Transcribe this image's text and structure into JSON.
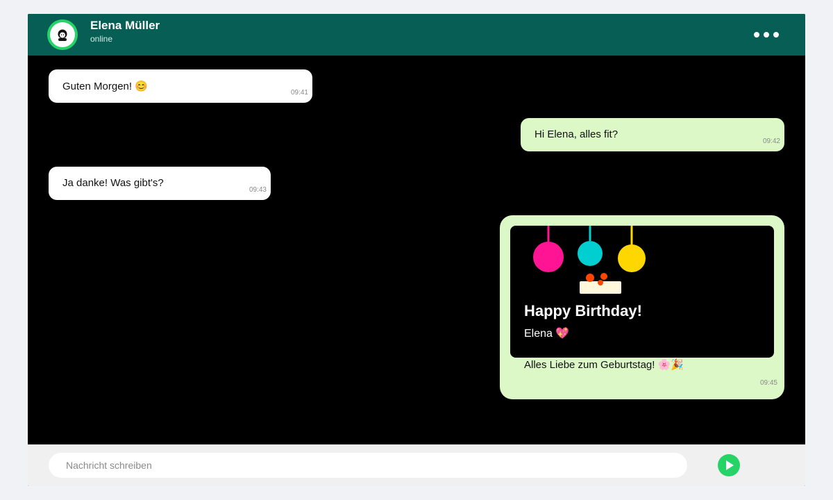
{
  "colors": {
    "header": "#075e54",
    "accent": "#25d366",
    "chat_background": "#000000",
    "incoming_bubble": "#ffffff",
    "outgoing_bubble": "#dcf8c6",
    "composer_background": "#f0f0f0",
    "balloons": [
      "#ff1493",
      "#00ced1",
      "#ffd700"
    ],
    "cake": "#fff8dc",
    "candles": "#ff4500"
  },
  "header": {
    "avatar_icon": "person-avatar-icon",
    "contact_name": "Elena Müller",
    "status": "online",
    "menu_icon": "more-options-icon"
  },
  "messages": [
    {
      "direction": "in",
      "text": "Guten Morgen! 😊",
      "time": "09:41"
    },
    {
      "direction": "out",
      "text": "Hi Elena, alles fit?",
      "time": "09:42"
    },
    {
      "direction": "in",
      "text": "Ja danke! Was gibt's?",
      "time": "09:43"
    }
  ],
  "birthday_card": {
    "title": "Happy Birthday!",
    "subtitle": "Elena 💖",
    "caption": "Alles Liebe zum Geburtstag! 🌸🎉",
    "time": "09:45",
    "decorations": [
      "balloon-icon",
      "balloon-icon",
      "balloon-icon",
      "cake-icon"
    ]
  },
  "composer": {
    "placeholder": "Nachricht schreiben",
    "value": "",
    "send_icon": "send-icon"
  }
}
